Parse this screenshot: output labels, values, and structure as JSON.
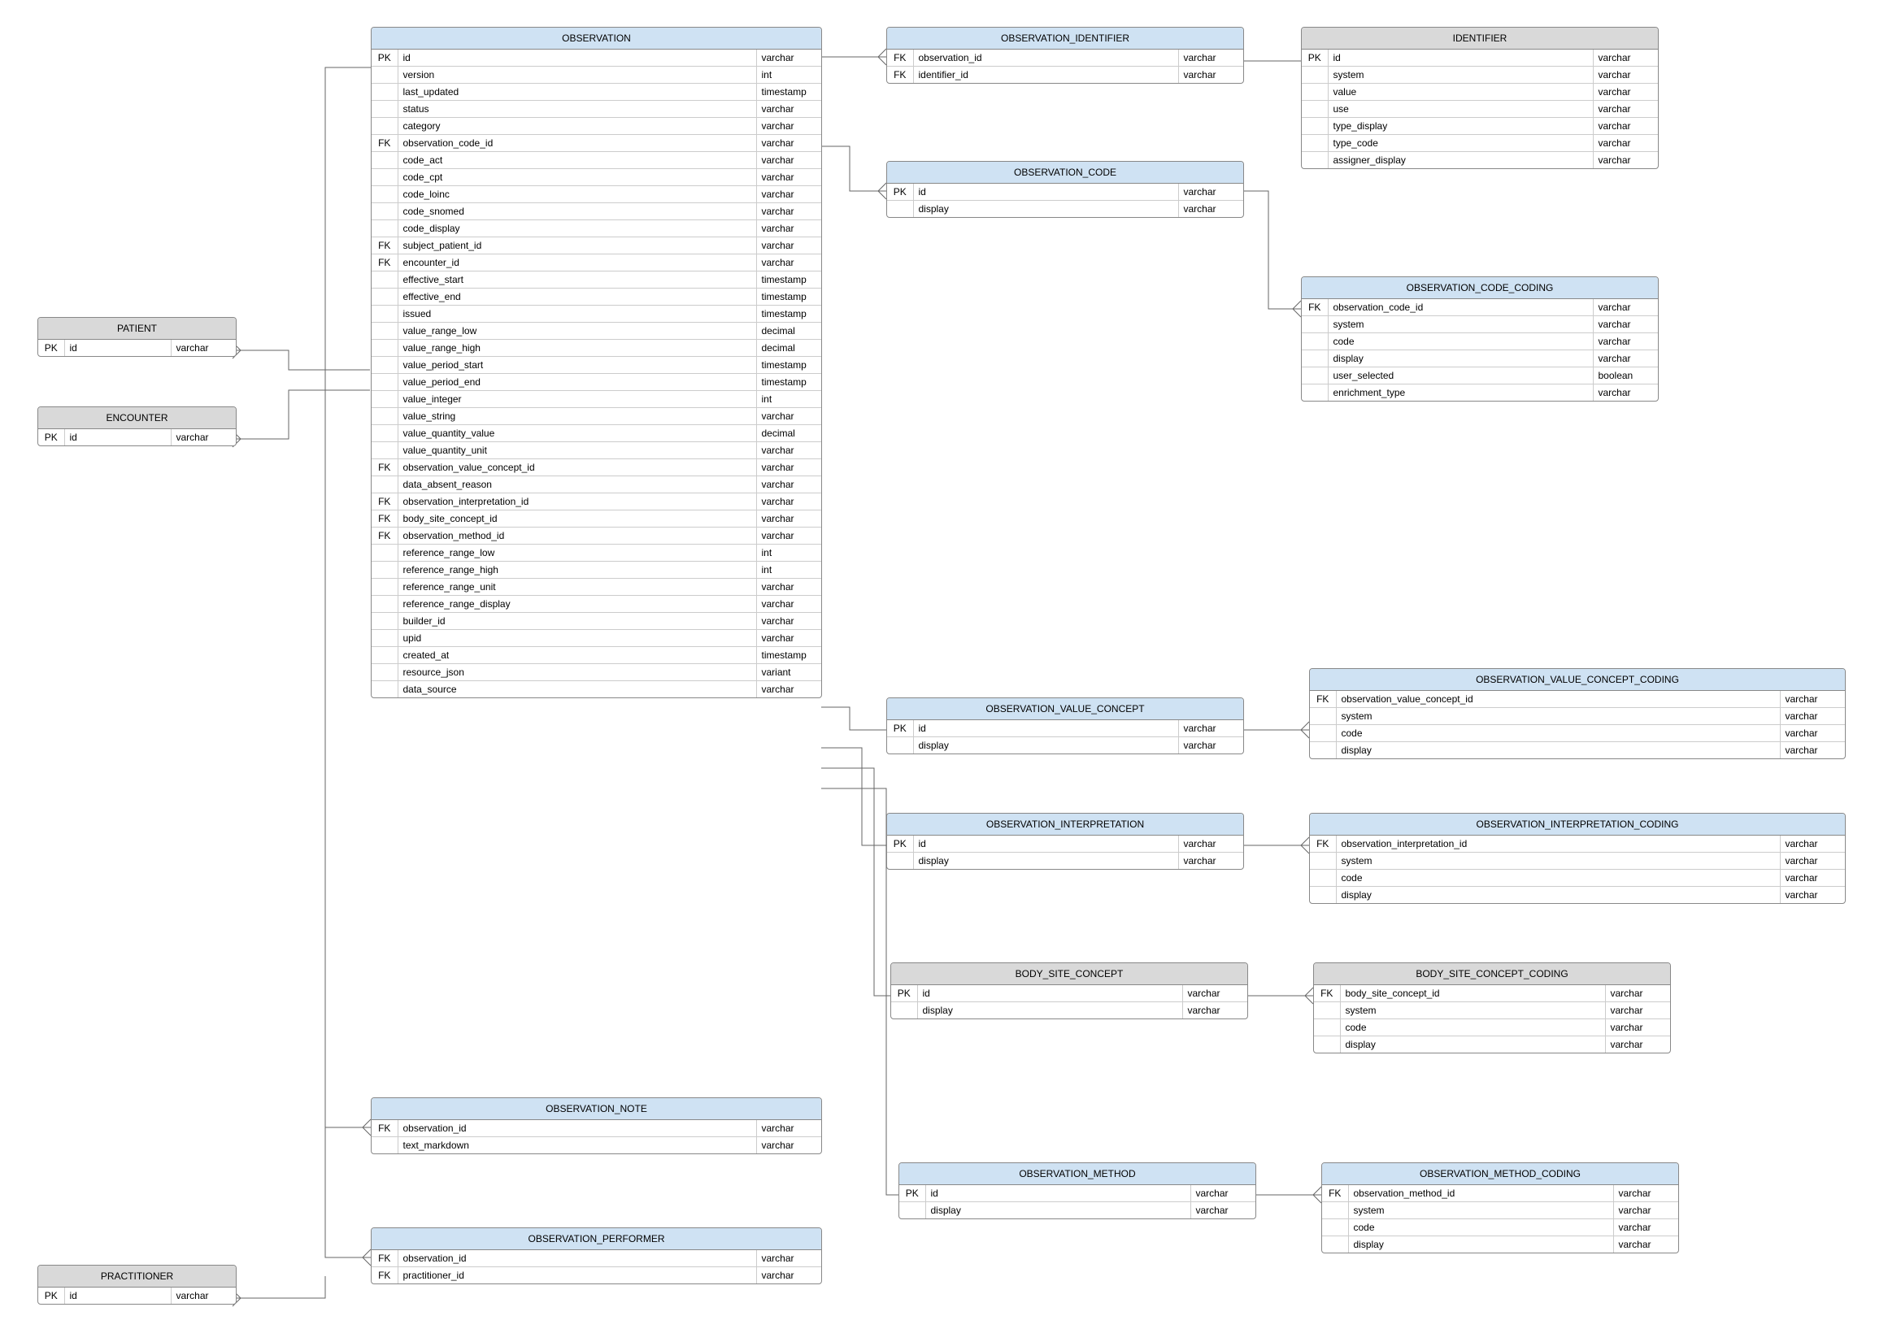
{
  "entities": {
    "patient": {
      "title": "PATIENT",
      "header": "grey",
      "rows": [
        {
          "key": "PK",
          "field": "id",
          "type": "varchar"
        }
      ]
    },
    "encounter": {
      "title": "ENCOUNTER",
      "header": "grey",
      "rows": [
        {
          "key": "PK",
          "field": "id",
          "type": "varchar"
        }
      ]
    },
    "practitioner": {
      "title": "PRACTITIONER",
      "header": "grey",
      "rows": [
        {
          "key": "PK",
          "field": "id",
          "type": "varchar"
        }
      ]
    },
    "observation": {
      "title": "OBSERVATION",
      "header": "blue",
      "rows": [
        {
          "key": "PK",
          "field": "id",
          "type": "varchar"
        },
        {
          "key": "",
          "field": "version",
          "type": "int"
        },
        {
          "key": "",
          "field": "last_updated",
          "type": "timestamp"
        },
        {
          "key": "",
          "field": "status",
          "type": "varchar"
        },
        {
          "key": "",
          "field": "category",
          "type": "varchar"
        },
        {
          "key": "FK",
          "field": "observation_code_id",
          "type": "varchar"
        },
        {
          "key": "",
          "field": "code_act",
          "type": "varchar"
        },
        {
          "key": "",
          "field": "code_cpt",
          "type": "varchar"
        },
        {
          "key": "",
          "field": "code_loinc",
          "type": "varchar"
        },
        {
          "key": "",
          "field": "code_snomed",
          "type": "varchar"
        },
        {
          "key": "",
          "field": "code_display",
          "type": "varchar"
        },
        {
          "key": "FK",
          "field": "subject_patient_id",
          "type": "varchar"
        },
        {
          "key": "FK",
          "field": "encounter_id",
          "type": "varchar"
        },
        {
          "key": "",
          "field": "effective_start",
          "type": "timestamp"
        },
        {
          "key": "",
          "field": "effective_end",
          "type": "timestamp"
        },
        {
          "key": "",
          "field": "issued",
          "type": "timestamp"
        },
        {
          "key": "",
          "field": "value_range_low",
          "type": "decimal"
        },
        {
          "key": "",
          "field": "value_range_high",
          "type": "decimal"
        },
        {
          "key": "",
          "field": "value_period_start",
          "type": "timestamp"
        },
        {
          "key": "",
          "field": "value_period_end",
          "type": "timestamp"
        },
        {
          "key": "",
          "field": "value_integer",
          "type": "int"
        },
        {
          "key": "",
          "field": "value_string",
          "type": "varchar"
        },
        {
          "key": "",
          "field": "value_quantity_value",
          "type": "decimal"
        },
        {
          "key": "",
          "field": "value_quantity_unit",
          "type": "varchar"
        },
        {
          "key": "FK",
          "field": "observation_value_concept_id",
          "type": "varchar"
        },
        {
          "key": "",
          "field": "data_absent_reason",
          "type": "varchar"
        },
        {
          "key": "FK",
          "field": "observation_interpretation_id",
          "type": "varchar"
        },
        {
          "key": "FK",
          "field": "body_site_concept_id",
          "type": "varchar"
        },
        {
          "key": "FK",
          "field": "observation_method_id",
          "type": "varchar"
        },
        {
          "key": "",
          "field": "reference_range_low",
          "type": "int"
        },
        {
          "key": "",
          "field": "reference_range_high",
          "type": "int"
        },
        {
          "key": "",
          "field": "reference_range_unit",
          "type": "varchar"
        },
        {
          "key": "",
          "field": "reference_range_display",
          "type": "varchar"
        },
        {
          "key": "",
          "field": "builder_id",
          "type": "varchar"
        },
        {
          "key": "",
          "field": "upid",
          "type": "varchar"
        },
        {
          "key": "",
          "field": "created_at",
          "type": "timestamp"
        },
        {
          "key": "",
          "field": "resource_json",
          "type": "variant"
        },
        {
          "key": "",
          "field": "data_source",
          "type": "varchar"
        }
      ]
    },
    "observation_identifier": {
      "title": "OBSERVATION_IDENTIFIER",
      "header": "blue",
      "rows": [
        {
          "key": "FK",
          "field": "observation_id",
          "type": "varchar"
        },
        {
          "key": "FK",
          "field": "identifier_id",
          "type": "varchar"
        }
      ]
    },
    "identifier": {
      "title": "IDENTIFIER",
      "header": "grey",
      "rows": [
        {
          "key": "PK",
          "field": "id",
          "type": "varchar"
        },
        {
          "key": "",
          "field": "system",
          "type": "varchar"
        },
        {
          "key": "",
          "field": "value",
          "type": "varchar"
        },
        {
          "key": "",
          "field": "use",
          "type": "varchar"
        },
        {
          "key": "",
          "field": "type_display",
          "type": "varchar"
        },
        {
          "key": "",
          "field": "type_code",
          "type": "varchar"
        },
        {
          "key": "",
          "field": "assigner_display",
          "type": "varchar"
        }
      ]
    },
    "observation_code": {
      "title": "OBSERVATION_CODE",
      "header": "blue",
      "rows": [
        {
          "key": "PK",
          "field": "id",
          "type": "varchar"
        },
        {
          "key": "",
          "field": "display",
          "type": "varchar"
        }
      ]
    },
    "observation_code_coding": {
      "title": "OBSERVATION_CODE_CODING",
      "header": "blue",
      "rows": [
        {
          "key": "FK",
          "field": "observation_code_id",
          "type": "varchar"
        },
        {
          "key": "",
          "field": "system",
          "type": "varchar"
        },
        {
          "key": "",
          "field": "code",
          "type": "varchar"
        },
        {
          "key": "",
          "field": "display",
          "type": "varchar"
        },
        {
          "key": "",
          "field": "user_selected",
          "type": "boolean"
        },
        {
          "key": "",
          "field": "enrichment_type",
          "type": "varchar"
        }
      ]
    },
    "observation_note": {
      "title": "OBSERVATION_NOTE",
      "header": "blue",
      "rows": [
        {
          "key": "FK",
          "field": "observation_id",
          "type": "varchar"
        },
        {
          "key": "",
          "field": "text_markdown",
          "type": "varchar"
        }
      ]
    },
    "observation_performer": {
      "title": "OBSERVATION_PERFORMER",
      "header": "blue",
      "rows": [
        {
          "key": "FK",
          "field": "observation_id",
          "type": "varchar"
        },
        {
          "key": "FK",
          "field": "practitioner_id",
          "type": "varchar"
        }
      ]
    },
    "observation_value_concept": {
      "title": "OBSERVATION_VALUE_CONCEPT",
      "header": "blue",
      "rows": [
        {
          "key": "PK",
          "field": "id",
          "type": "varchar"
        },
        {
          "key": "",
          "field": "display",
          "type": "varchar"
        }
      ]
    },
    "observation_value_concept_coding": {
      "title": "OBSERVATION_VALUE_CONCEPT_CODING",
      "header": "blue",
      "rows": [
        {
          "key": "FK",
          "field": "observation_value_concept_id",
          "type": "varchar"
        },
        {
          "key": "",
          "field": "system",
          "type": "varchar"
        },
        {
          "key": "",
          "field": "code",
          "type": "varchar"
        },
        {
          "key": "",
          "field": "display",
          "type": "varchar"
        }
      ]
    },
    "observation_interpretation": {
      "title": "OBSERVATION_INTERPRETATION",
      "header": "blue",
      "rows": [
        {
          "key": "PK",
          "field": "id",
          "type": "varchar"
        },
        {
          "key": "",
          "field": "display",
          "type": "varchar"
        }
      ]
    },
    "observation_interpretation_coding": {
      "title": "OBSERVATION_INTERPRETATION_CODING",
      "header": "blue",
      "rows": [
        {
          "key": "FK",
          "field": "observation_interpretation_id",
          "type": "varchar"
        },
        {
          "key": "",
          "field": "system",
          "type": "varchar"
        },
        {
          "key": "",
          "field": "code",
          "type": "varchar"
        },
        {
          "key": "",
          "field": "display",
          "type": "varchar"
        }
      ]
    },
    "body_site_concept": {
      "title": "BODY_SITE_CONCEPT",
      "header": "grey",
      "rows": [
        {
          "key": "PK",
          "field": "id",
          "type": "varchar"
        },
        {
          "key": "",
          "field": "display",
          "type": "varchar"
        }
      ]
    },
    "body_site_concept_coding": {
      "title": "BODY_SITE_CONCEPT_CODING",
      "header": "grey",
      "rows": [
        {
          "key": "FK",
          "field": "body_site_concept_id",
          "type": "varchar"
        },
        {
          "key": "",
          "field": "system",
          "type": "varchar"
        },
        {
          "key": "",
          "field": "code",
          "type": "varchar"
        },
        {
          "key": "",
          "field": "display",
          "type": "varchar"
        }
      ]
    },
    "observation_method": {
      "title": "OBSERVATION_METHOD",
      "header": "blue",
      "rows": [
        {
          "key": "PK",
          "field": "id",
          "type": "varchar"
        },
        {
          "key": "",
          "field": "display",
          "type": "varchar"
        }
      ]
    },
    "observation_method_coding": {
      "title": "OBSERVATION_METHOD_CODING",
      "header": "blue",
      "rows": [
        {
          "key": "FK",
          "field": "observation_method_id",
          "type": "varchar"
        },
        {
          "key": "",
          "field": "system",
          "type": "varchar"
        },
        {
          "key": "",
          "field": "code",
          "type": "varchar"
        },
        {
          "key": "",
          "field": "display",
          "type": "varchar"
        }
      ]
    }
  }
}
